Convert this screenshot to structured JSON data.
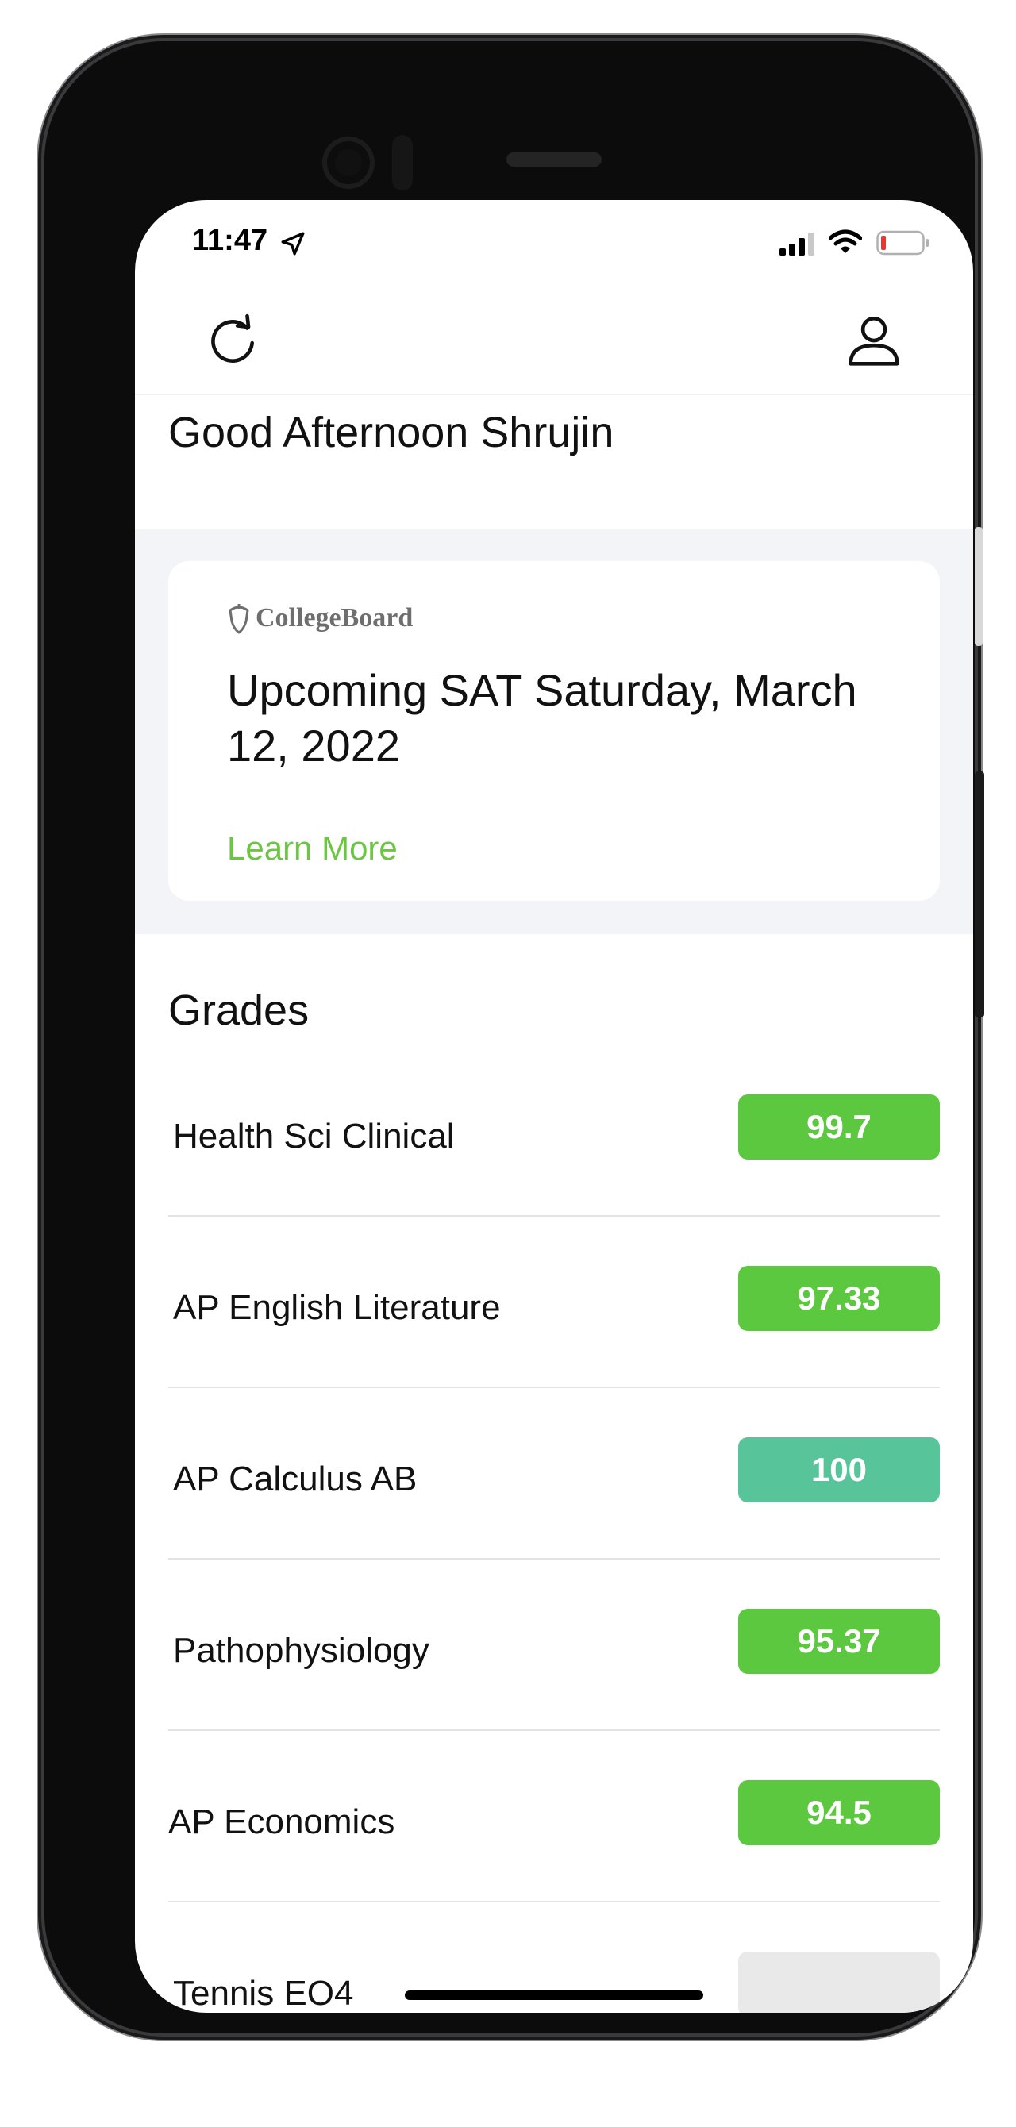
{
  "status_bar": {
    "time": "11:47",
    "icons": [
      "location-arrow-icon",
      "cellular-signal-icon",
      "wifi-icon",
      "battery-low-icon"
    ],
    "battery_color": "#e53935"
  },
  "topbar": {
    "left_icon": "refresh-icon",
    "right_icon": "user-profile-icon"
  },
  "greeting": "Good Afternoon Shrujin",
  "banner": {
    "logo_text": "CollegeBoard",
    "logo_icon": "acorn-shield-icon",
    "title": "Upcoming SAT Saturday, March 12, 2022",
    "link_label": "Learn More",
    "link_color": "#6cc644",
    "band_color": "#f3f4f7"
  },
  "grades": {
    "title": "Grades",
    "items": [
      {
        "course": "Health Sci Clinical",
        "grade": "99.7",
        "color": "#5cc83f"
      },
      {
        "course": "AP English Literature",
        "grade": "97.33",
        "color": "#5cc83f"
      },
      {
        "course": "AP Calculus AB",
        "grade": "100",
        "color": "#58c49a"
      },
      {
        "course": "Pathophysiology",
        "grade": "95.37",
        "color": "#5cc83f"
      },
      {
        "course": "AP Economics",
        "grade": "94.5",
        "color": "#5cc83f"
      },
      {
        "course": "Tennis EO4",
        "grade": "",
        "color": "#e9e9ea"
      }
    ]
  }
}
